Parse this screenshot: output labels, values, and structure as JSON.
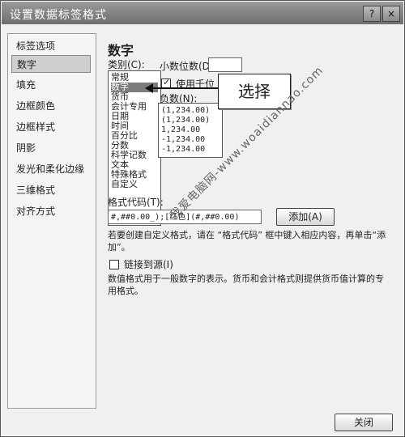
{
  "window": {
    "title": "设置数据标签格式",
    "help_button": "?",
    "close_button": "×"
  },
  "sidebar": {
    "items": [
      {
        "label": "标签选项"
      },
      {
        "label": "数字"
      },
      {
        "label": "填充"
      },
      {
        "label": "边框颜色"
      },
      {
        "label": "边框样式"
      },
      {
        "label": "阴影"
      },
      {
        "label": "发光和柔化边缘"
      },
      {
        "label": "三维格式"
      },
      {
        "label": "对齐方式"
      }
    ]
  },
  "panel": {
    "heading": "数字",
    "category_label": "类别(C):",
    "categories": [
      "常规",
      "数字",
      "货币",
      "会计专用",
      "日期",
      "时间",
      "百分比",
      "分数",
      "科学记数",
      "文本",
      "特殊格式",
      "自定义"
    ],
    "selected_category": "数字",
    "decimal_label": "小数位数(D):",
    "thousands_label": "使用千位",
    "negative_label": "负数(N):",
    "negatives": [
      "(1,234.00)",
      "(1,234.00)",
      "1,234.00",
      "-1,234.00",
      "-1,234.00"
    ],
    "format_code_label": "格式代码(T):",
    "format_code_value": "#,##0.00_);[红色](#,##0.00)",
    "add_button": "添加(A)",
    "custom_hint": "若要创建自定义格式，请在 “格式代码” 框中键入相应内容，再单击“添加”。",
    "link_source_label": "链接到源(I)",
    "number_desc": "数值格式用于一般数字的表示。货币和会计格式则提供货币值计算的专用格式。"
  },
  "annotation": {
    "callout_text": "选择",
    "watermark": "我爱电脑网-www.woaidiannao.com"
  },
  "footer": {
    "close_button": "关闭"
  }
}
